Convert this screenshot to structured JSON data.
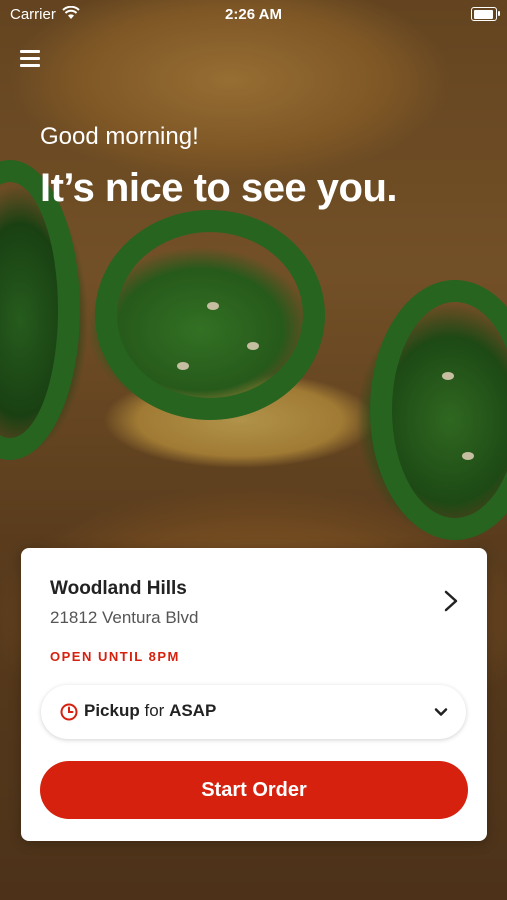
{
  "status_bar": {
    "carrier": "Carrier",
    "time": "2:26 AM"
  },
  "header": {
    "menu_icon": "hamburger-menu-icon",
    "greeting": "Good morning!",
    "headline": "It’s nice to see you."
  },
  "location_card": {
    "name": "Woodland Hills",
    "address": "21812 Ventura Blvd",
    "open_status": "OPEN UNTIL 8PM",
    "order_mode": {
      "icon": "clock-icon",
      "mode": "Pickup",
      "connector": "for",
      "time": "ASAP"
    },
    "start_button_label": "Start Order"
  },
  "colors": {
    "accent": "#d6210f",
    "card_background": "#ffffff"
  }
}
